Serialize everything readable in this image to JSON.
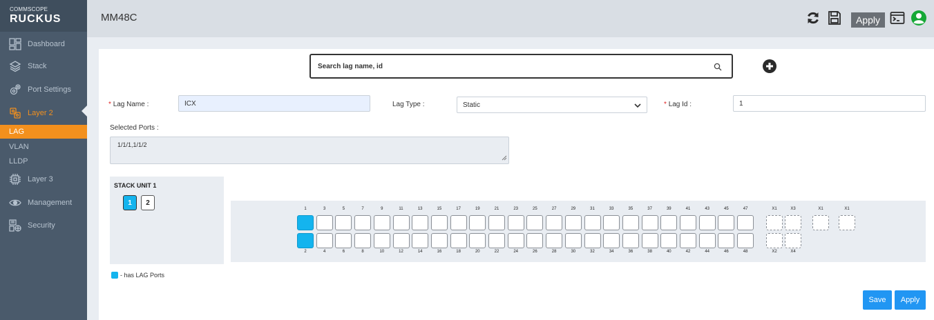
{
  "brand": {
    "top": "COMMSCOPE",
    "name": "RUCKUS"
  },
  "sidebar": {
    "items": [
      {
        "label": "Dashboard",
        "icon": "dashboard-icon"
      },
      {
        "label": "Stack",
        "icon": "stack-icon"
      },
      {
        "label": "Port Settings",
        "icon": "gears-icon"
      },
      {
        "label": "Layer 2",
        "icon": "layer2-icon"
      },
      {
        "label": "Layer 3",
        "icon": "chip-icon"
      },
      {
        "label": "Management",
        "icon": "eye-icon"
      },
      {
        "label": "Security",
        "icon": "security-icon"
      }
    ],
    "subitems": [
      {
        "label": "LAG"
      },
      {
        "label": "VLAN"
      },
      {
        "label": "LLDP"
      }
    ]
  },
  "header": {
    "device_name": "MM48C",
    "apply_label": "Apply"
  },
  "search": {
    "placeholder": "Search lag name, id"
  },
  "form": {
    "required_mark": "*",
    "lag_name_label": "Lag Name :",
    "lag_name_value": "ICX",
    "lag_type_label": "Lag Type :",
    "lag_type_value": "Static",
    "lag_id_label": "Lag Id :",
    "lag_id_value": "1",
    "selected_ports_label": "Selected Ports :",
    "selected_ports_value": "1/1/1,1/1/2"
  },
  "stack": {
    "title": "STACK UNIT 1",
    "units": [
      "1",
      "2"
    ],
    "selected_unit": "1"
  },
  "ports": {
    "top_labels": [
      "1",
      "3",
      "5",
      "7",
      "9",
      "11",
      "13",
      "15",
      "17",
      "19",
      "21",
      "23",
      "25",
      "27",
      "29",
      "31",
      "33",
      "35",
      "37",
      "39",
      "41",
      "43",
      "45",
      "47"
    ],
    "bottom_labels": [
      "2",
      "4",
      "6",
      "8",
      "10",
      "12",
      "14",
      "16",
      "18",
      "20",
      "22",
      "24",
      "26",
      "28",
      "30",
      "32",
      "34",
      "36",
      "38",
      "40",
      "42",
      "44",
      "46",
      "48"
    ],
    "lag_ports": [
      "1",
      "2"
    ],
    "uplink_top_labels": [
      "X1",
      "X3",
      "X1",
      "X1"
    ],
    "uplink_bottom_labels": [
      "X2",
      "X4"
    ]
  },
  "legend": {
    "text": "- has LAG Ports"
  },
  "buttons": {
    "save": "Save",
    "apply": "Apply"
  },
  "colors": {
    "accent": "#f3901d",
    "lag_port": "#14b4ee",
    "primary_button": "#2196f3",
    "sidebar": "#4a5a6b"
  }
}
